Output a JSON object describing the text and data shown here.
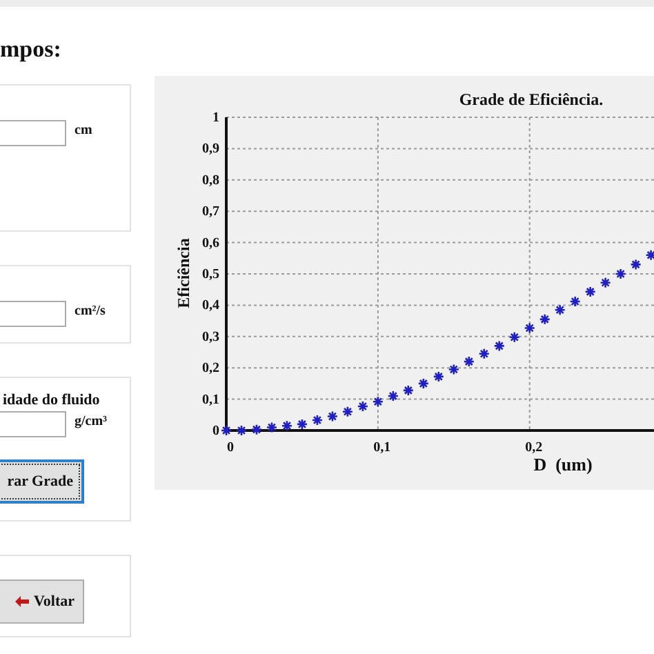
{
  "heading": "mpos:",
  "panels": [
    {
      "field": {
        "unit": "cm"
      }
    },
    {
      "field": {
        "unit": "cm²/s"
      }
    },
    {
      "label": "idade do fluido",
      "field": {
        "unit": "g/cm³"
      },
      "button": {
        "kind": "plain",
        "label": "rar Grade",
        "focused": true
      }
    },
    {
      "button": {
        "kind": "back",
        "label": "Voltar",
        "focused": false
      }
    }
  ],
  "chart": {
    "chart_data": {
      "type": "scatter",
      "title": "Grade de Eficiência.",
      "xlabel": "D  (um)",
      "ylabel": "Eficiência",
      "x": [
        0,
        0.01,
        0.02,
        0.03,
        0.04,
        0.05,
        0.06,
        0.07,
        0.08,
        0.09,
        0.1,
        0.11,
        0.12,
        0.13,
        0.14,
        0.15,
        0.16,
        0.17,
        0.18,
        0.19,
        0.2,
        0.21,
        0.22,
        0.23,
        0.24,
        0.25,
        0.26,
        0.27,
        0.28
      ],
      "grid": true,
      "series": [
        {
          "color": "#2020c0",
          "values": [
            0,
            0,
            0.003,
            0.01,
            0.015,
            0.02,
            0.033,
            0.045,
            0.06,
            0.077,
            0.092,
            0.11,
            0.128,
            0.15,
            0.172,
            0.195,
            0.22,
            0.245,
            0.27,
            0.298,
            0.327,
            0.355,
            0.385,
            0.412,
            0.443,
            0.472,
            0.5,
            0.53,
            0.56
          ]
        }
      ],
      "xlim": [
        0,
        0.282
      ],
      "ylim": [
        0,
        1
      ],
      "xticks": [
        {
          "value": 0,
          "label": "0"
        },
        {
          "value": 0.1,
          "label": "0,1"
        },
        {
          "value": 0.2,
          "label": "0,2"
        }
      ],
      "yticks": [
        {
          "value": 0,
          "label": "0"
        },
        {
          "value": 0.1,
          "label": "0,1"
        },
        {
          "value": 0.2,
          "label": "0,2"
        },
        {
          "value": 0.3,
          "label": "0,3"
        },
        {
          "value": 0.4,
          "label": "0,4"
        },
        {
          "value": 0.5,
          "label": "0,5"
        },
        {
          "value": 0.6,
          "label": "0,6"
        },
        {
          "value": 0.7,
          "label": "0,7"
        },
        {
          "value": 0.8,
          "label": "0,8"
        },
        {
          "value": 0.9,
          "label": "0,9"
        },
        {
          "value": 1,
          "label": "1"
        }
      ]
    }
  }
}
